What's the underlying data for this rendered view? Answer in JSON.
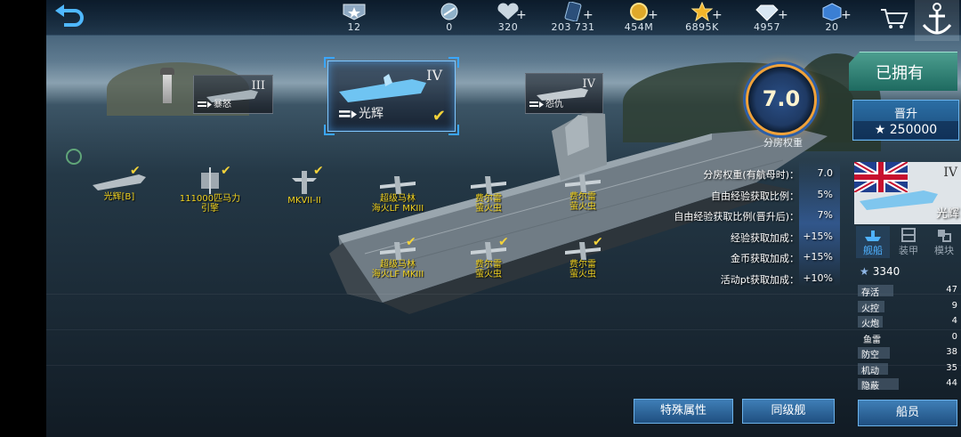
{
  "top_bar": {
    "back_icon": "back-arrow-icon",
    "resources": [
      {
        "id": "rank",
        "icon": "rank-badge-icon",
        "value": "12",
        "plus": false
      },
      {
        "id": "blueprint",
        "icon": "blueprint-coin-icon",
        "value": "0",
        "plus": false
      },
      {
        "id": "fleet_points",
        "icon": "heart-icon",
        "value": "320",
        "plus": true
      },
      {
        "id": "cards",
        "icon": "card-icon",
        "value": "203 731",
        "plus": true
      },
      {
        "id": "gold",
        "icon": "gold-coin-icon",
        "value": "454M",
        "plus": true
      },
      {
        "id": "stars",
        "icon": "star-icon",
        "value": "6895K",
        "plus": true
      },
      {
        "id": "diamonds",
        "icon": "diamond-icon",
        "value": "4957",
        "plus": true
      },
      {
        "id": "cubes",
        "icon": "cube-icon",
        "value": "20",
        "plus": true
      }
    ],
    "plus_label": "+",
    "shop_icon": "shopping-cart-icon",
    "anchor_icon": "anchor-icon"
  },
  "ship_cards": [
    {
      "tier": "III",
      "name": "暴怒",
      "selected": false
    },
    {
      "tier": "IV",
      "name": "光辉",
      "selected": true
    },
    {
      "tier": "IV",
      "name": "怨仇",
      "selected": false
    }
  ],
  "aircraft": [
    {
      "label": "光辉[B]",
      "checked": true
    },
    {
      "label_1": "111000匹马力",
      "label_2": "引擎",
      "checked": true
    },
    {
      "label": "MKVII-II",
      "checked": true
    },
    {
      "label_1": "超级马林",
      "label_2": "海火LF MKIII",
      "checked": false
    },
    {
      "label_1": "费尔雷",
      "label_2": "萤火虫",
      "checked": false
    },
    {
      "label_1": "费尔雷",
      "label_2": "萤火虫",
      "checked": false
    },
    {
      "label_1": "超级马林",
      "label_2": "海火LF MKIII",
      "checked": true
    },
    {
      "label_1": "费尔雷",
      "label_2": "萤火虫",
      "checked": true
    },
    {
      "label_1": "费尔雷",
      "label_2": "萤火虫",
      "checked": true
    }
  ],
  "rating": {
    "value": "7.0",
    "label": "分房权重"
  },
  "stats": [
    {
      "key": "分房权重(有航母时)：",
      "value": "7.0"
    },
    {
      "key": "自由经验获取比例：",
      "value": "5%"
    },
    {
      "key": "自由经验获取比例(晋升后)：",
      "value": "7%"
    },
    {
      "key": "经验获取加成：",
      "value": "+15%"
    },
    {
      "key": "金币获取加成：",
      "value": "+15%"
    },
    {
      "key": "活动pt获取加成：",
      "value": "+10%"
    }
  ],
  "right_panel": {
    "owned_label": "已拥有",
    "promote_title": "晋升",
    "promote_cost": "★ 250000",
    "ship_tier": "IV",
    "ship_name": "光辉",
    "flag": "uk-naval-ensign",
    "tabs": [
      {
        "label": "舰船",
        "icon": "ship-tab-icon",
        "active": true
      },
      {
        "label": "装甲",
        "icon": "armor-tab-icon",
        "active": false
      },
      {
        "label": "模块",
        "icon": "module-tab-icon",
        "active": false
      }
    ],
    "power_star": "★",
    "power": "3340",
    "attributes": [
      {
        "name": "存活",
        "value": "47"
      },
      {
        "name": "火控",
        "value": "9"
      },
      {
        "name": "火炮",
        "value": "4"
      },
      {
        "name": "鱼雷",
        "value": "0"
      },
      {
        "name": "防空",
        "value": "38"
      },
      {
        "name": "机动",
        "value": "35"
      },
      {
        "name": "隐蔽",
        "value": "44"
      }
    ],
    "crew_label": "船员"
  },
  "bottom_buttons": {
    "special": "特殊属性",
    "sister": "同级舰"
  },
  "colors": {
    "accent_yellow": "#f1d21f",
    "accent_blue": "#3aa6ff",
    "owned_green": "#2f8576"
  }
}
